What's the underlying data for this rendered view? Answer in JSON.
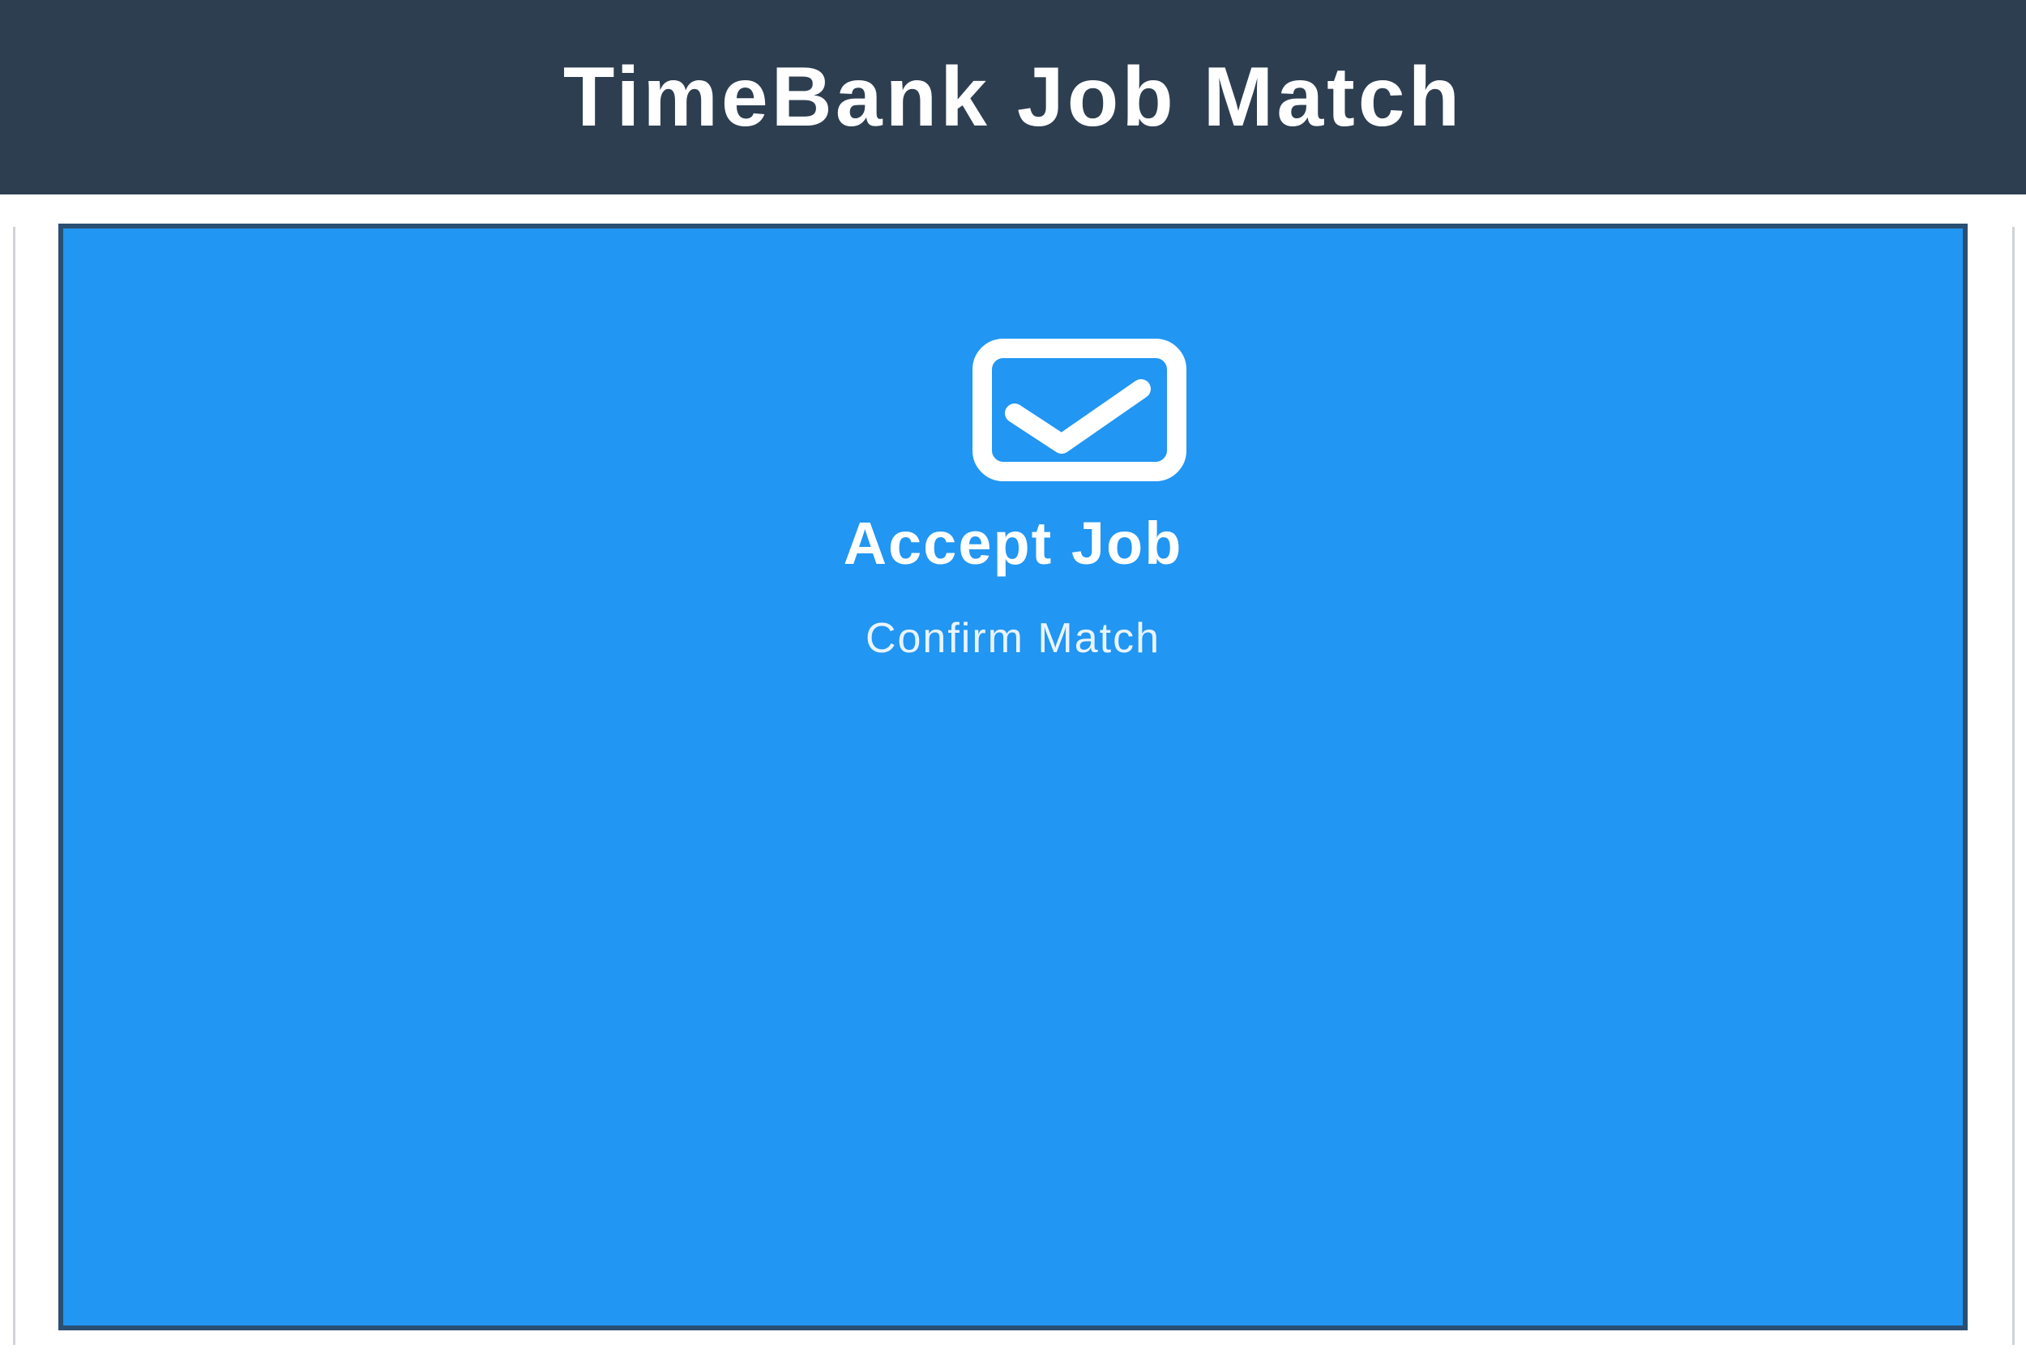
{
  "header": {
    "title": "TimeBank Job Match"
  },
  "action_card": {
    "icon": "checkbox-checked-icon",
    "title": "Accept Job",
    "subtitle": "Confirm Match"
  },
  "colors": {
    "header_bg": "#2d3e50",
    "card_bg": "#2196f3",
    "card_border": "#2a4f72",
    "text": "#ffffff"
  }
}
